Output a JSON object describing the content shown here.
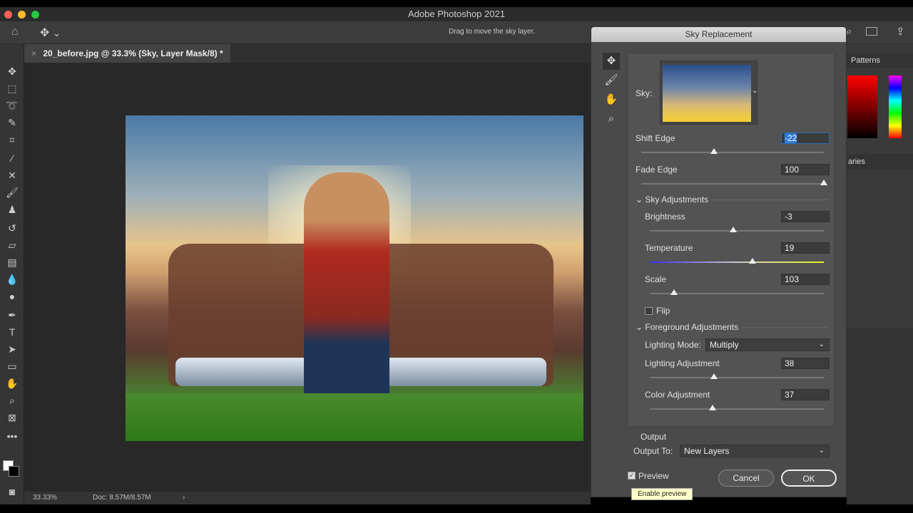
{
  "window": {
    "title": "Adobe Photoshop 2021"
  },
  "options": {
    "hint": "Drag to move the sky layer."
  },
  "document": {
    "tab_label": "20_before.jpg @ 33.3% (Sky, Layer Mask/8) *",
    "close": "×"
  },
  "status": {
    "zoom": "33.33%",
    "doc": "Doc: 8.57M/8.57M",
    "arrow": "›"
  },
  "right_panel": {
    "tab1": "Patterns",
    "tab2": "aries"
  },
  "dialog": {
    "title": "Sky Replacement",
    "sky_label": "Sky:",
    "shift_edge": {
      "label": "Shift Edge",
      "value": "-22",
      "fraction": 0.4
    },
    "fade_edge": {
      "label": "Fade Edge",
      "value": "100",
      "fraction": 1.0
    },
    "sky_adjustments": "Sky Adjustments",
    "brightness": {
      "label": "Brightness",
      "value": "-3",
      "fraction": 0.48
    },
    "temperature": {
      "label": "Temperature",
      "value": "19",
      "fraction": 0.59
    },
    "scale": {
      "label": "Scale",
      "value": "103",
      "fraction": 0.14
    },
    "flip": {
      "label": "Flip",
      "checked": false
    },
    "foreground_adjustments": "Foreground Adjustments",
    "lighting_mode": {
      "label": "Lighting Mode:",
      "value": "Multiply"
    },
    "lighting_adjustment": {
      "label": "Lighting Adjustment",
      "value": "38",
      "fraction": 0.37
    },
    "color_adjustment": {
      "label": "Color Adjustment",
      "value": "37",
      "fraction": 0.36
    },
    "output": {
      "heading": "Output",
      "label": "Output To:",
      "value": "New Layers"
    },
    "preview": {
      "label": "Preview",
      "checked": true,
      "tooltip": "Enable preview"
    },
    "cancel": "Cancel",
    "ok": "OK"
  }
}
